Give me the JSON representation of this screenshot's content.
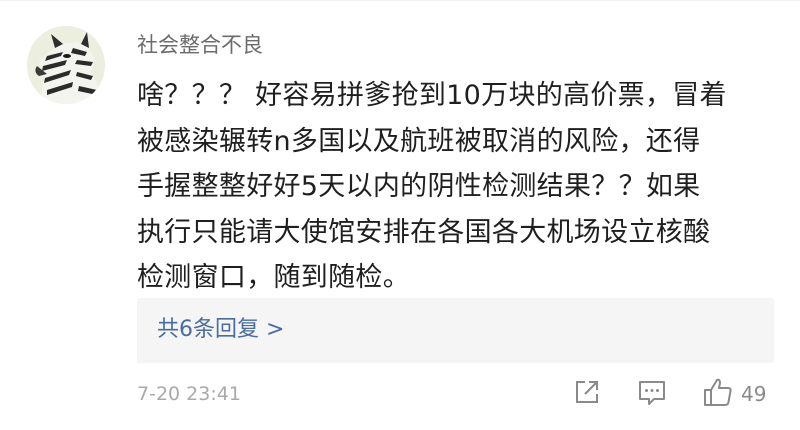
{
  "comment": {
    "username": "社会整合不良",
    "avatar_icon": "zebra-avatar-icon",
    "lines": [
      "啥？？？ 好容易拼爹抢到10万块的高价票，冒着",
      "被感染辗转n多国以及航班被取消的风险，还得",
      "手握整整好好5天以内的阴性检测结果？？如果",
      "执行只能请大使馆安排在各国各大机场设立核酸",
      "检测窗口，随到随检。"
    ],
    "replies_label": "共6条回复 >",
    "timestamp": "7-20 23:41",
    "like_count": "49"
  },
  "actions": {
    "share_icon": "share-icon",
    "reply_icon": "comment-icon",
    "like_icon": "thumbs-up-icon"
  },
  "colors": {
    "username": "#6b6b6b",
    "text": "#1f1f1f",
    "link": "#4a6c9e",
    "meta": "#a9a9a9",
    "reply_bg": "#f5f5f5"
  }
}
